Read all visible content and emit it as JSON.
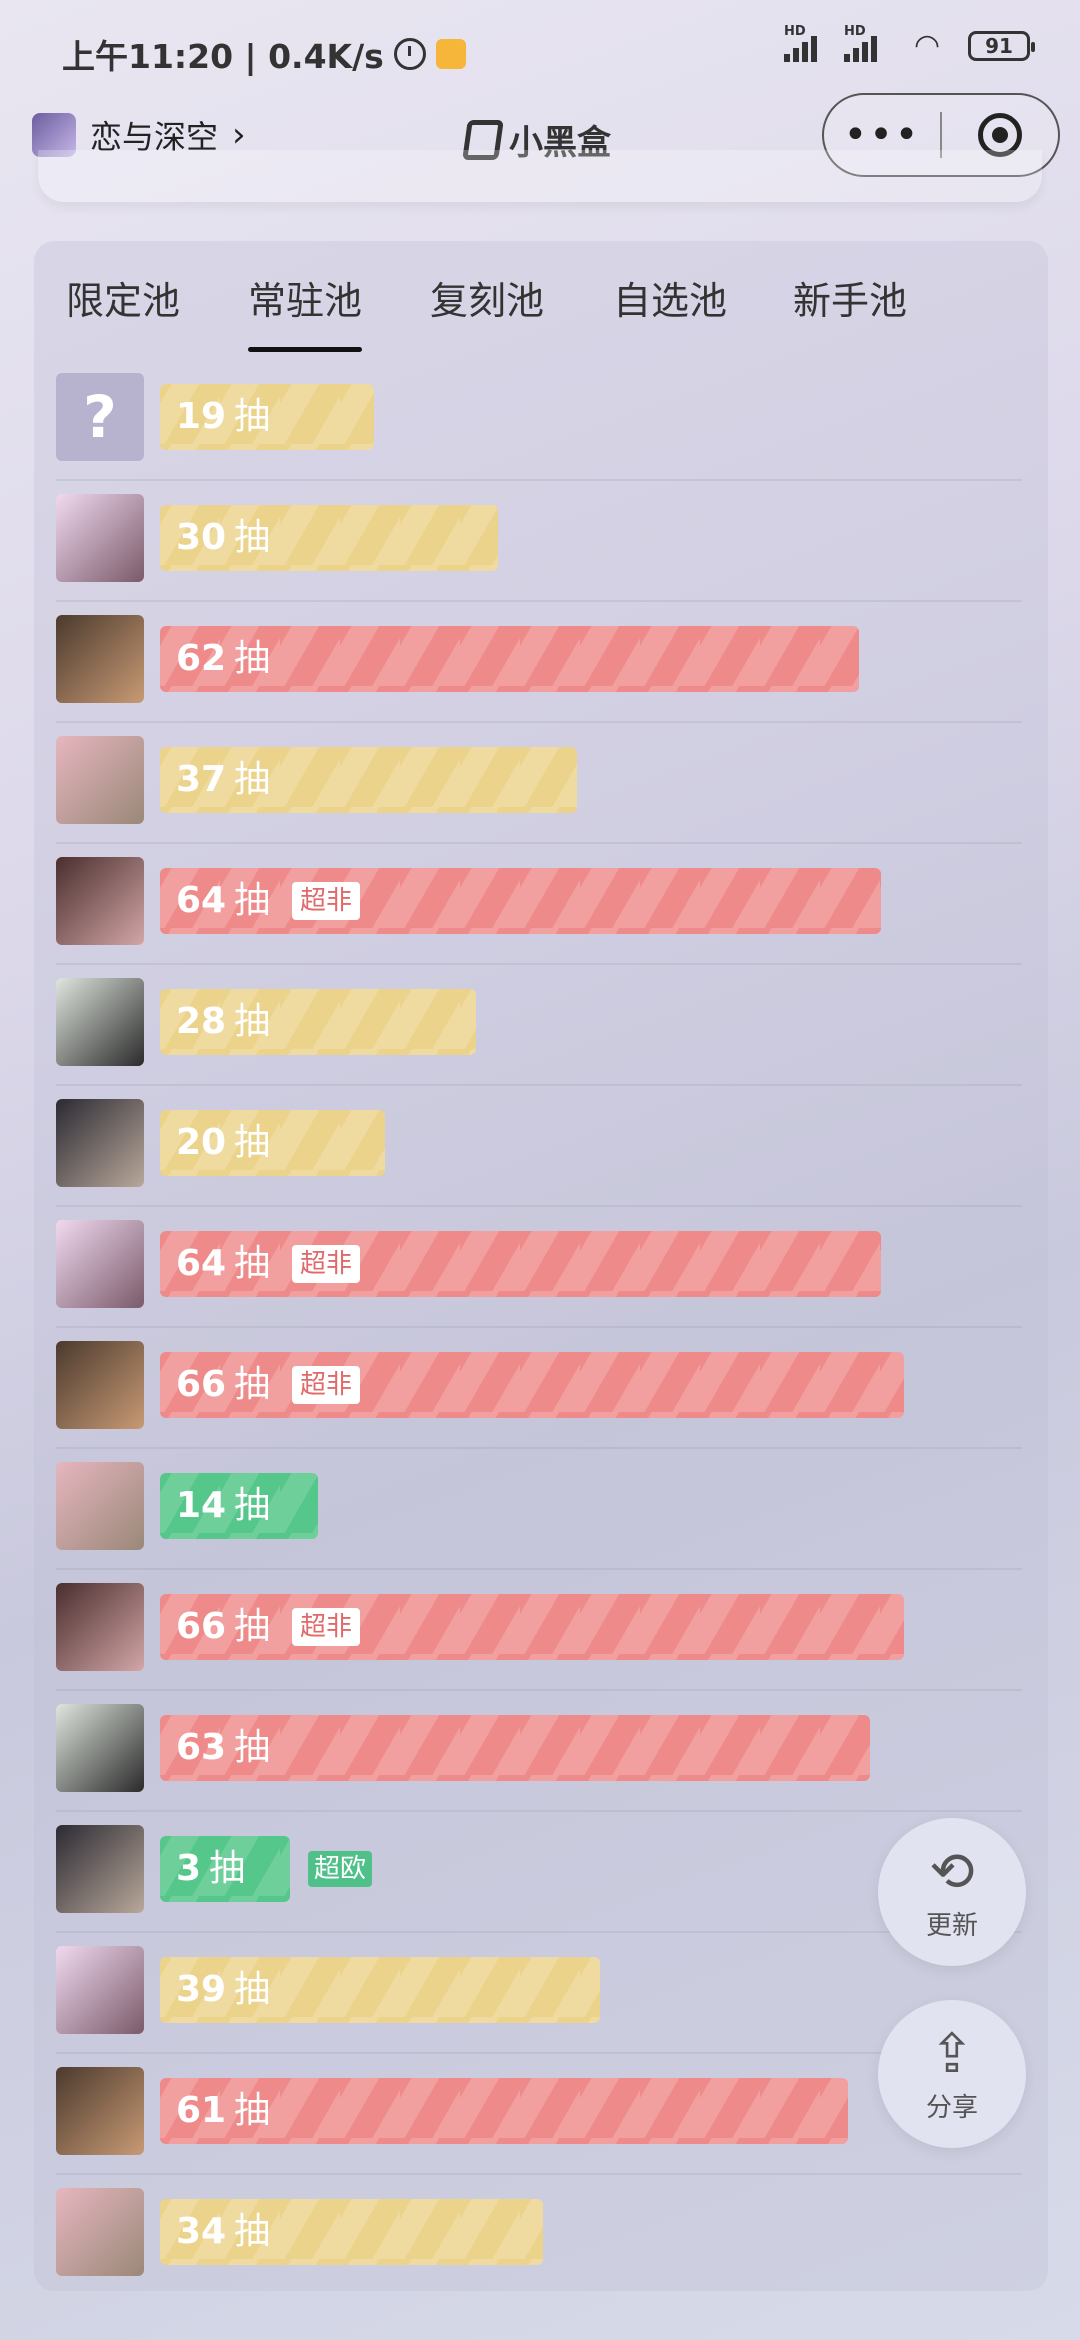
{
  "status_bar": {
    "time_speed": "上午11:20 | 0.4K/s",
    "battery": "91",
    "signal_tag": "HD"
  },
  "nav": {
    "back_title": "恋与深空",
    "brand": "小黑盒"
  },
  "tabs": [
    "限定池",
    "常驻池",
    "复刻池",
    "自选池",
    "新手池"
  ],
  "active_tab": "常驻池",
  "unit": "抽",
  "badges": {
    "super_unlucky": "超非",
    "super_lucky": "超欧"
  },
  "rows": [
    {
      "count": "19",
      "color": "yellow",
      "avatar": "unknown-avatar"
    },
    {
      "count": "30",
      "color": "yellow",
      "avatar": "character-avatar"
    },
    {
      "count": "62",
      "color": "red",
      "avatar": "character-avatar"
    },
    {
      "count": "37",
      "color": "yellow",
      "avatar": "character-avatar"
    },
    {
      "count": "64",
      "color": "red",
      "avatar": "character-avatar",
      "badge": "超非"
    },
    {
      "count": "28",
      "color": "yellow",
      "avatar": "character-avatar"
    },
    {
      "count": "20",
      "color": "yellow",
      "avatar": "character-avatar"
    },
    {
      "count": "64",
      "color": "red",
      "avatar": "character-avatar",
      "badge": "超非"
    },
    {
      "count": "66",
      "color": "red",
      "avatar": "character-avatar",
      "badge": "超非"
    },
    {
      "count": "14",
      "color": "green",
      "avatar": "character-avatar"
    },
    {
      "count": "66",
      "color": "red",
      "avatar": "character-avatar",
      "badge": "超非"
    },
    {
      "count": "63",
      "color": "red",
      "avatar": "character-avatar"
    },
    {
      "count": "3",
      "color": "green",
      "avatar": "character-avatar",
      "badge": "超欧"
    },
    {
      "count": "39",
      "color": "yellow",
      "avatar": "character-avatar"
    },
    {
      "count": "61",
      "color": "red",
      "avatar": "character-avatar"
    },
    {
      "count": "34",
      "color": "yellow",
      "avatar": "character-avatar"
    }
  ],
  "fab": {
    "refresh_label": "更新",
    "share_label": "分享",
    "refresh_icon": "refresh-icon",
    "share_icon": "share-icon"
  },
  "colors": {
    "yellow": "#ecd38b",
    "red": "#ee8a8a",
    "green": "#55c78a"
  }
}
